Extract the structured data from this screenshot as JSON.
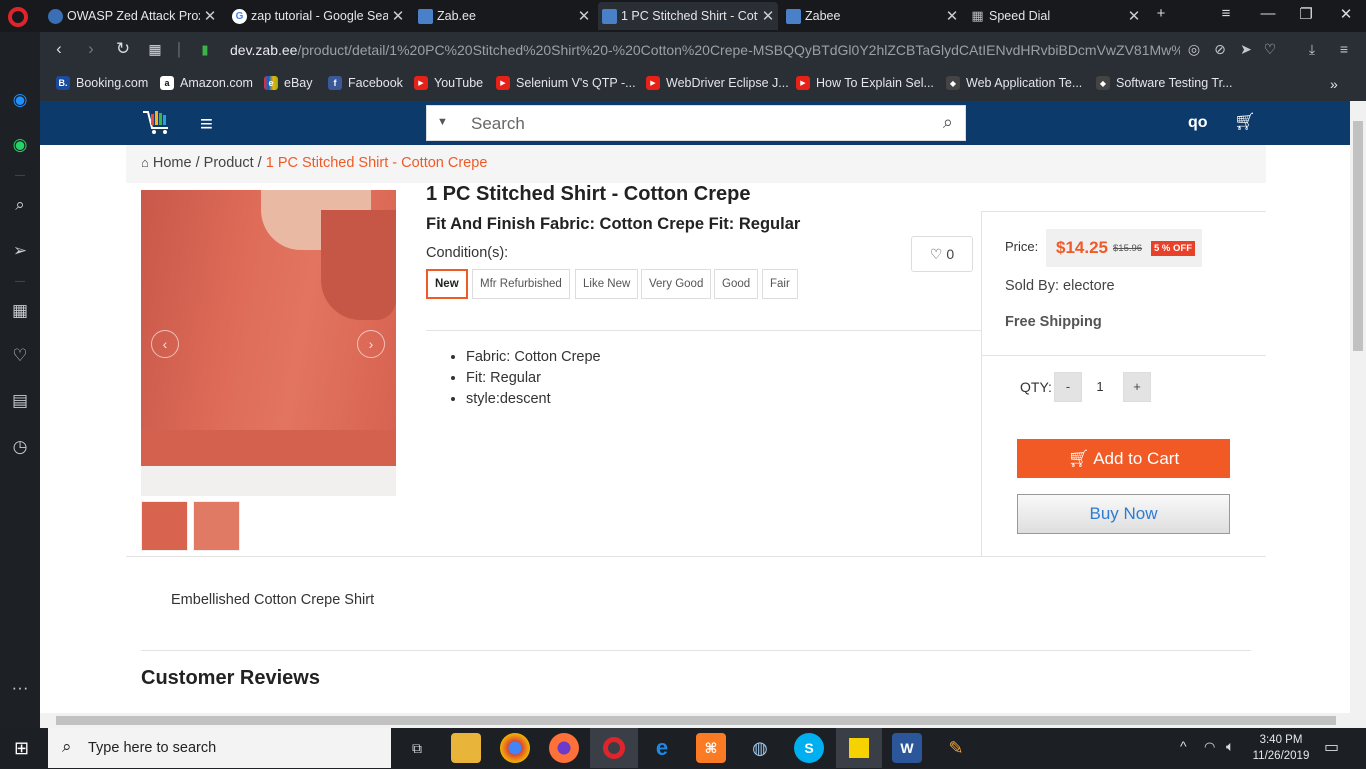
{
  "tabs": [
    {
      "label": "OWASP Zed Attack Prox",
      "favicon_color": "#3a6fb5",
      "active": false
    },
    {
      "label": "zap tutorial - Google Sea",
      "favicon_color": "#ffffff",
      "active": false
    },
    {
      "label": "Zab.ee",
      "favicon_color": "#4a80c8",
      "active": false
    },
    {
      "label": "1 PC Stitched Shirt - Cott",
      "favicon_color": "#4a80c8",
      "active": true
    },
    {
      "label": "Zabee",
      "favicon_color": "#4a80c8",
      "active": false
    },
    {
      "label": "Speed Dial",
      "favicon_color": "#9aa0a8",
      "active": false
    }
  ],
  "address": {
    "host": "dev.zab.ee",
    "path": "/product/detail/1%20PC%20Stitched%20Shirt%20-%20Cotton%20Crepe-MSBQQyBTdGl0Y2hlZCBTaGlydCAtIENvdHRvbiBDcmVwZV81Mw%3D%"
  },
  "bookmarks": [
    {
      "label": "Booking.com",
      "color": "#1a4b9c",
      "glyph": "B."
    },
    {
      "label": "Amazon.com",
      "color": "#ffffff",
      "glyph": "a"
    },
    {
      "label": "eBay",
      "color": "#e53238",
      "glyph": "e"
    },
    {
      "label": "Facebook",
      "color": "#3b5998",
      "glyph": "f"
    },
    {
      "label": "YouTube",
      "color": "#e62117",
      "glyph": "▶"
    },
    {
      "label": "Selenium V's QTP -...",
      "color": "#e62117",
      "glyph": "▶"
    },
    {
      "label": "WebDriver Eclipse J...",
      "color": "#e62117",
      "glyph": "▶"
    },
    {
      "label": "How To Explain Sel...",
      "color": "#e62117",
      "glyph": "▶"
    },
    {
      "label": "Web Application Te...",
      "color": "#444444",
      "glyph": "◆"
    },
    {
      "label": "Software Testing Tr...",
      "color": "#444444",
      "glyph": "◆"
    }
  ],
  "site": {
    "search_placeholder": "Search",
    "user": "qo"
  },
  "breadcrumb": {
    "home": "Home",
    "sep": " / ",
    "product": "Product",
    "current": "1 PC Stitched Shirt - Cotton Crepe"
  },
  "product": {
    "title": "1 PC Stitched Shirt - Cotton Crepe",
    "subtitle": "Fit And Finish Fabric: Cotton Crepe Fit: Regular",
    "condition_label": "Condition(s):",
    "conditions": [
      "New",
      "Mfr Refurbished",
      "Like New",
      "Very Good",
      "Good",
      "Fair"
    ],
    "selected_condition": "New",
    "wishlist_count": "0",
    "features": [
      "Fabric: Cotton Crepe",
      "Fit: Regular",
      "style:descent"
    ],
    "price_label": "Price:",
    "price": "$14.25",
    "old_price": "$15.96",
    "discount": "5 % OFF",
    "sold_by": "Sold By: electore",
    "shipping": "Free Shipping",
    "qty_label": "QTY:",
    "qty_minus": "-",
    "qty": "1",
    "qty_plus": "+",
    "add_to_cart": "Add to Cart",
    "buy_now": "Buy Now",
    "description": "Embellished Cotton Crepe Shirt",
    "reviews_title": "Customer Reviews"
  },
  "taskbar": {
    "search_placeholder": "Type here to search",
    "time": "3:40 PM",
    "date": "11/26/2019"
  },
  "colors": {
    "accent": "#f05a28",
    "header": "#0b3a6b",
    "buy_now_text": "#2f7bd0"
  }
}
